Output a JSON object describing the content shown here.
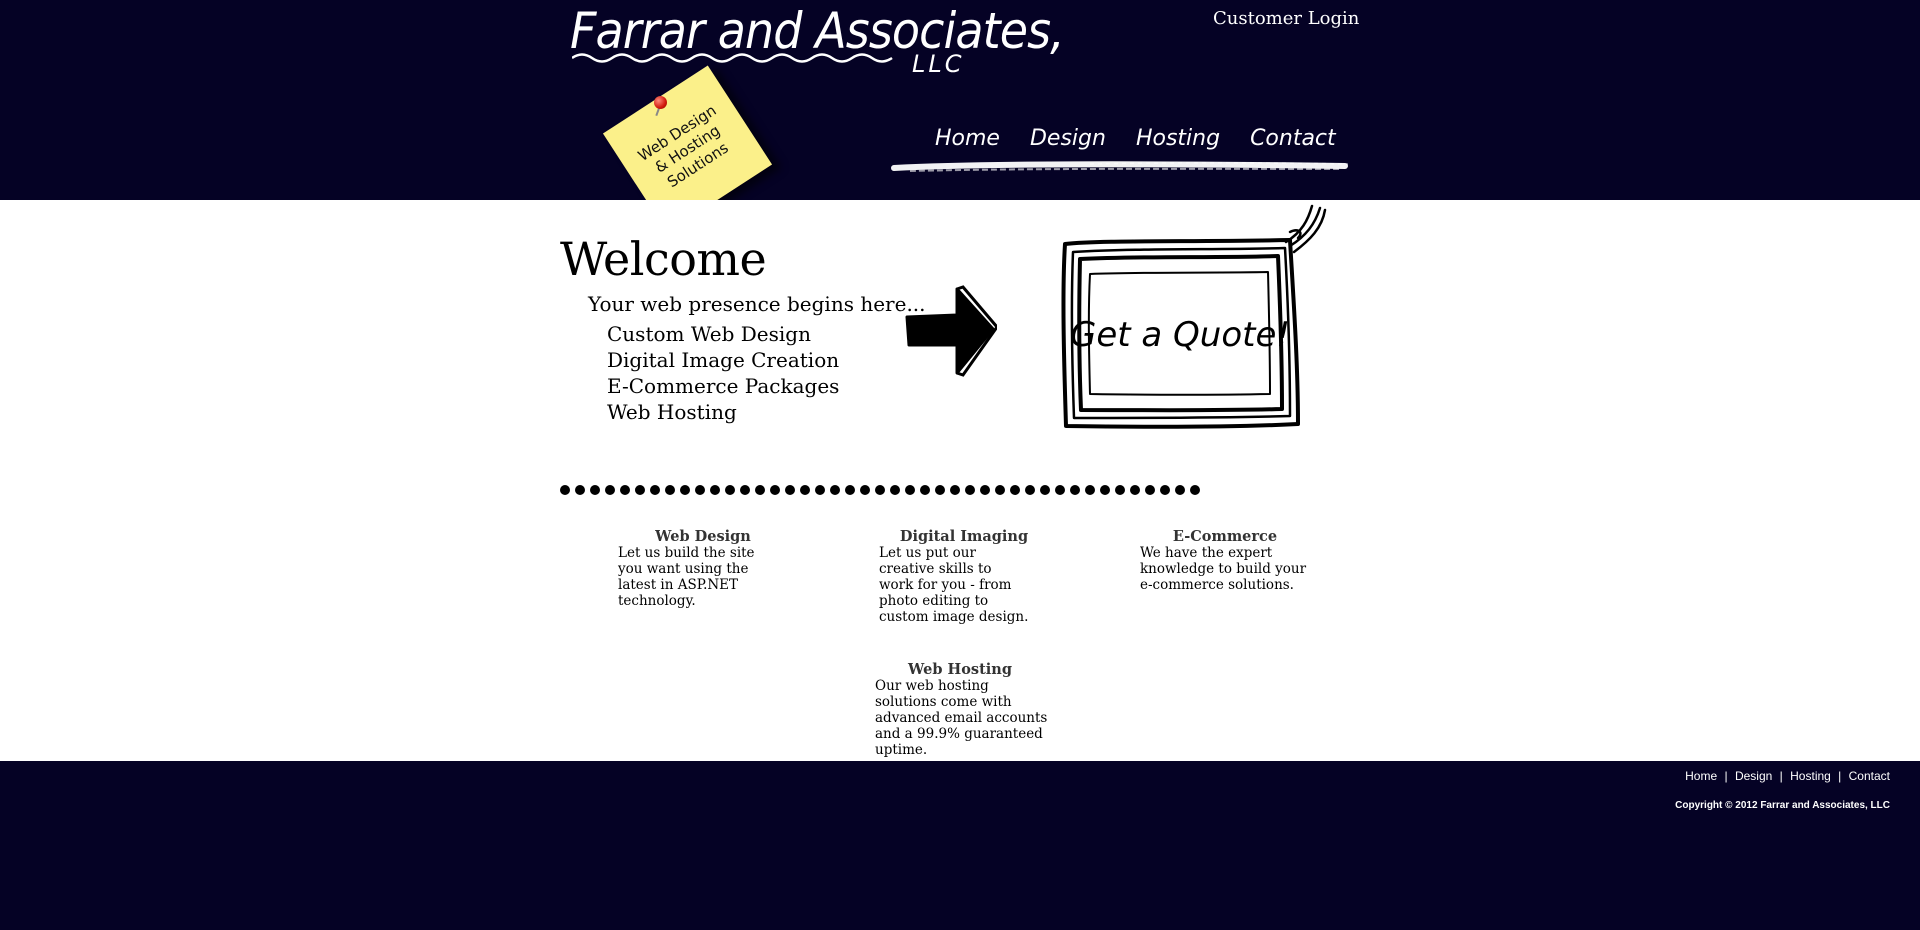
{
  "header": {
    "logo_text": "Farrar and Associates,",
    "logo_suffix": "LLC",
    "customer_login": "Customer Login",
    "sticky_note": "Web Design & Hosting Solutions",
    "nav": [
      "Home",
      "Design",
      "Hosting",
      "Contact"
    ]
  },
  "main": {
    "welcome": "Welcome",
    "tagline": "Your web presence begins here...",
    "services": [
      "Custom Web Design",
      "Digital Image Creation",
      "E-Commerce Packages",
      "Web Hosting"
    ],
    "quote_button": "Get a Quote!",
    "features": [
      {
        "title": "Web Design",
        "text": "Let us build the site you want using the latest in ASP.NET technology."
      },
      {
        "title": "Digital Imaging",
        "text": "Let us put our creative skills to work for you - from photo editing to custom image design."
      },
      {
        "title": "E-Commerce",
        "text": "We have the expert knowledge to build your e-commerce solutions."
      },
      {
        "title": "Web Hosting",
        "text": "Our web hosting solutions come with advanced email accounts and a 99.9% guaranteed uptime."
      }
    ]
  },
  "footer": {
    "nav": [
      "Home",
      "Design",
      "Hosting",
      "Contact"
    ],
    "separator": "|",
    "copyright": "Copyright © 2012 Farrar and Associates, LLC"
  },
  "colors": {
    "background": "#050225",
    "content": "#ffffff",
    "sticky": "#fbf08a"
  }
}
